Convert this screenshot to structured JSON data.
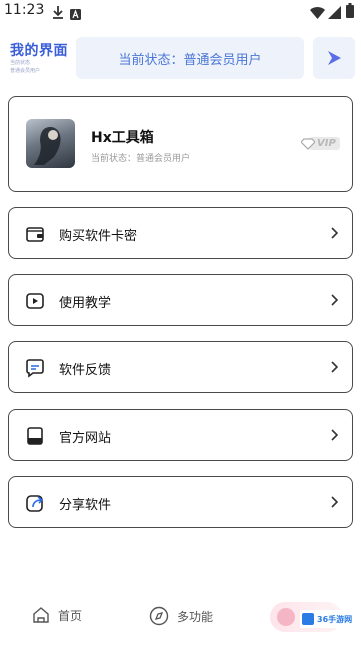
{
  "status_bar": {
    "time": "11:23"
  },
  "header": {
    "title": "我的界面",
    "subtitle_1": "当前状态",
    "subtitle_2": "普通会员用户",
    "status_text": "当前状态：普通会员用户"
  },
  "profile": {
    "name": "Hx工具箱",
    "status": "当前状态：普通会员用户",
    "badge": "VIP"
  },
  "menu": {
    "items": [
      {
        "label": "购买软件卡密",
        "icon": "wallet-icon"
      },
      {
        "label": "使用教学",
        "icon": "video-play-icon"
      },
      {
        "label": "软件反馈",
        "icon": "chat-bubble-icon"
      },
      {
        "label": "官方网站",
        "icon": "book-icon"
      },
      {
        "label": "分享软件",
        "icon": "share-icon"
      }
    ]
  },
  "bottom_nav": {
    "items": [
      {
        "label": "首页",
        "icon": "home-icon"
      },
      {
        "label": "多功能",
        "icon": "compass-icon"
      }
    ]
  },
  "watermark": "36手游网",
  "colors": {
    "accent": "#3a5ed8",
    "card_bg": "#eef2fb",
    "play": "#5b6ee8"
  }
}
